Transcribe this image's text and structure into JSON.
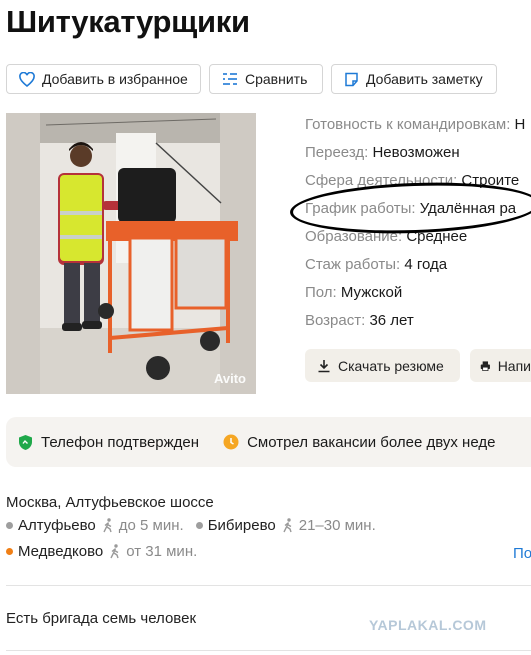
{
  "page": {
    "title": "Шитукатурщики"
  },
  "actions": [
    {
      "label": "Добавить в избранное",
      "icon": "heart-icon"
    },
    {
      "label": "Сравнить",
      "icon": "compare-icon"
    },
    {
      "label": "Добавить заметку",
      "icon": "note-icon"
    }
  ],
  "photo": {
    "watermark": "Avito"
  },
  "details": [
    {
      "label": "Готовность к командировкам:",
      "value": "Н"
    },
    {
      "label": "Переезд:",
      "value": "Невозможен"
    },
    {
      "label": "Сфера деятельности:",
      "value": "Строите"
    },
    {
      "label": "График работы:",
      "value": "Удалённая ра"
    },
    {
      "label": "Образование:",
      "value": "Среднее"
    },
    {
      "label": "Стаж работы:",
      "value": "4 года"
    },
    {
      "label": "Пол:",
      "value": "Мужской"
    },
    {
      "label": "Возраст:",
      "value": "36 лет"
    }
  ],
  "buttons": {
    "download_resume": "Скачать резюме",
    "write": "Напи"
  },
  "badges": {
    "phone": "Телефон подтвержден",
    "vacancies": "Смотрел вакансии более двух неде"
  },
  "location": {
    "address": "Москва, Алтуфьевское шоссе",
    "metro": [
      {
        "name": "Алтуфьево",
        "time": "до 5 мин.",
        "color": "#9e9e9e"
      },
      {
        "name": "Бибирево",
        "time": "21–30 мин.",
        "color": "#9e9e9e"
      },
      {
        "name": "Медведково",
        "time": "от 31 мин.",
        "color": "#f07f16"
      }
    ],
    "link": "По"
  },
  "about": {
    "text": "Есть бригада семь человек"
  },
  "watermark": {
    "site": "YAPLAKAL.COM"
  },
  "colors": {
    "accent_link": "#1f7ad6",
    "phone_badge": "#1fa84a",
    "vacancy_badge": "#f5a623"
  }
}
